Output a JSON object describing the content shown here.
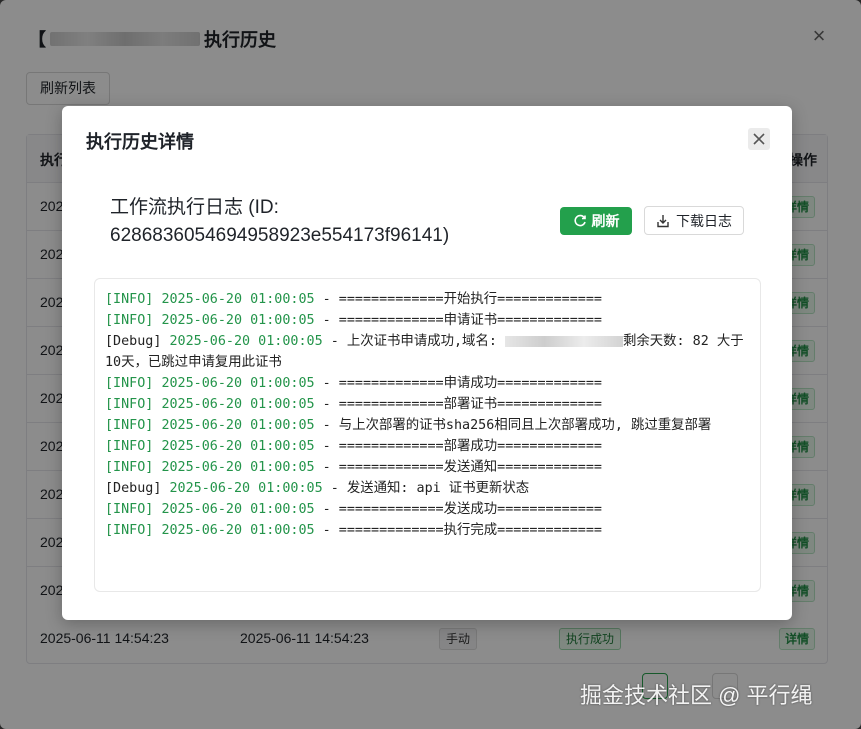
{
  "outer": {
    "title_prefix": "【",
    "title_suffix": "执行历史",
    "refresh_list_label": "刷新列表",
    "columns": {
      "col1": "执行",
      "col_ops": "操作"
    },
    "rows": [
      {
        "c1": "2025",
        "detail": "详情"
      },
      {
        "c1": "2025",
        "detail": "详情"
      },
      {
        "c1": "2025",
        "detail": "详情"
      },
      {
        "c1": "2025",
        "detail": "详情"
      },
      {
        "c1": "2025",
        "detail": "详情"
      },
      {
        "c1": "2025",
        "detail": "详情"
      },
      {
        "c1": "2025",
        "detail": "详情"
      },
      {
        "c1": "2025",
        "detail": "详情"
      },
      {
        "c1": "2025",
        "detail": "详情"
      }
    ],
    "last_row": {
      "start": "2025-06-11 14:54:23",
      "end": "2025-06-11 14:54:23",
      "trigger": "手动",
      "status": "执行成功",
      "detail": "详情"
    }
  },
  "modal": {
    "title": "执行历史详情",
    "heading": "工作流执行日志 (ID: 6286836054694958923e554173f96141)",
    "refresh_label": "刷新",
    "download_label": "下载日志",
    "log": [
      {
        "level": "[INFO]",
        "time": "2025-06-20 01:00:05",
        "msg": " - =============开始执行============="
      },
      {
        "level": "[INFO]",
        "time": "2025-06-20 01:00:05",
        "msg": " - =============申请证书============="
      },
      {
        "level": "[Debug]",
        "time": "2025-06-20 01:00:05",
        "msg": " - 上次证书申请成功,域名: ",
        "msg_after": "剩余天数: 82 大于10天，已跳过申请复用此证书",
        "redacted": true
      },
      {
        "level": "[INFO]",
        "time": "2025-06-20 01:00:05",
        "msg": " - =============申请成功============="
      },
      {
        "level": "[INFO]",
        "time": "2025-06-20 01:00:05",
        "msg": " - =============部署证书============="
      },
      {
        "level": "[INFO]",
        "time": "2025-06-20 01:00:05",
        "msg": " - 与上次部署的证书sha256相同且上次部署成功, 跳过重复部署"
      },
      {
        "level": "[INFO]",
        "time": "2025-06-20 01:00:05",
        "msg": " - =============部署成功============="
      },
      {
        "level": "[INFO]",
        "time": "2025-06-20 01:00:05",
        "msg": " - =============发送通知============="
      },
      {
        "level": "[Debug]",
        "time": "2025-06-20 01:00:05",
        "msg": " - 发送通知: api 证书更新状态"
      },
      {
        "level": "[INFO]",
        "time": "2025-06-20 01:00:05",
        "msg": " - =============发送成功============="
      },
      {
        "level": "[INFO]",
        "time": "2025-06-20 01:00:05",
        "msg": " - =============执行完成============="
      }
    ]
  },
  "watermark": "掘金技术社区 @ 平行绳",
  "colors": {
    "accent": "#23a04c",
    "info": "#23944a"
  }
}
